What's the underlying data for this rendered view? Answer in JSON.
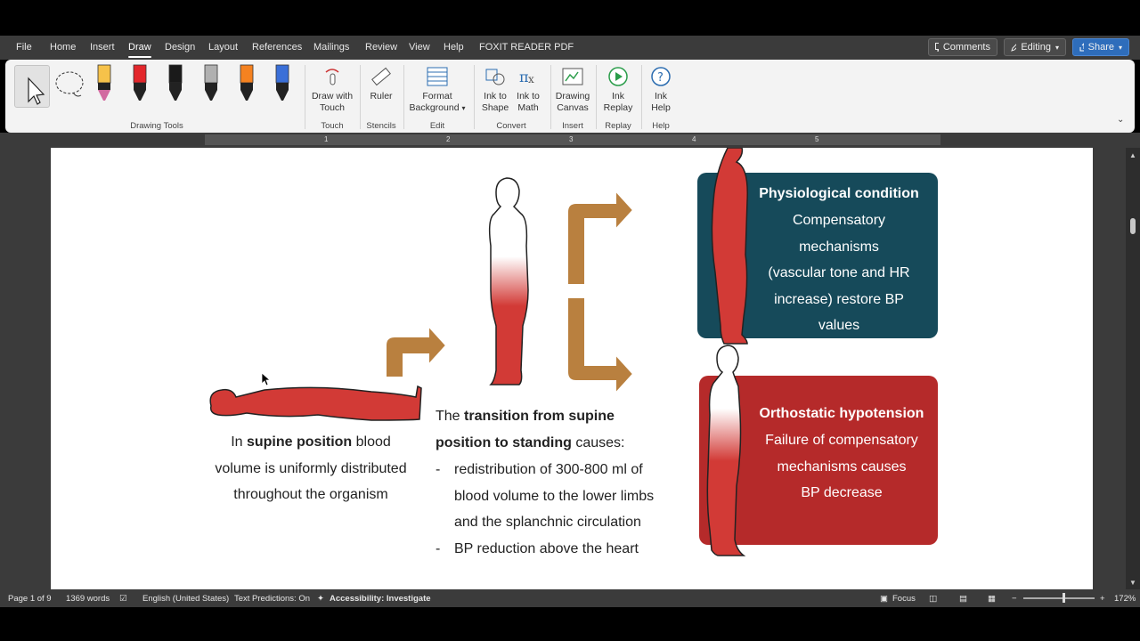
{
  "tabs": [
    "File",
    "Home",
    "Insert",
    "Draw",
    "Design",
    "Layout",
    "References",
    "Mailings",
    "Review",
    "View",
    "Help",
    "FOXIT READER PDF"
  ],
  "top_buttons": {
    "comments": "Comments",
    "editing": "Editing",
    "share": "Share"
  },
  "ribbon": {
    "groups": {
      "drawing_tools": "Drawing Tools",
      "touch": "Touch",
      "stencils": "Stencils",
      "edit": "Edit",
      "convert": "Convert",
      "insert": "Insert",
      "replay": "Replay",
      "help": "Help"
    },
    "buttons": {
      "draw_with_touch": [
        "Draw with",
        "Touch"
      ],
      "ruler": "Ruler",
      "format_background": [
        "Format",
        "Background"
      ],
      "ink_to_shape": [
        "Ink to",
        "Shape"
      ],
      "ink_to_math": [
        "Ink to",
        "Math"
      ],
      "drawing_canvas": [
        "Drawing",
        "Canvas"
      ],
      "ink_replay": [
        "Ink",
        "Replay"
      ],
      "ink_help": [
        "Ink",
        "Help"
      ]
    },
    "pen_colors": [
      "#f6c24a",
      "#e3262b",
      "#1a1a1a",
      "#b0b0b0",
      "#f58220",
      "#3a6fd8"
    ]
  },
  "ruler_numbers": [
    "1",
    "2",
    "3",
    "4",
    "5"
  ],
  "document": {
    "supine": {
      "line1_a": "In ",
      "line1_b": "supine position",
      "line1_c": " blood",
      "line2": "volume is uniformly distributed",
      "line3": "throughout the organism"
    },
    "transition": {
      "line1_a": "The ",
      "line1_b": "transition from supine",
      "line2_b": "position to standing",
      "line2_c": " causes:",
      "bullet_marker": "-",
      "bullet1_line1": "redistribution of 300-800 ml of",
      "bullet1_line2": "blood volume to the lower limbs",
      "bullet1_line3": "and the splanchnic circulation",
      "bullet2": "BP reduction above the heart"
    },
    "card_physio": {
      "title": "Physiological condition",
      "lines": [
        "Compensatory",
        "mechanisms",
        "(vascular tone and HR",
        "increase) restore BP",
        "values"
      ],
      "color": "#164a5a"
    },
    "card_ortho": {
      "title": "Orthostatic hypotension",
      "lines": [
        "Failure of compensatory",
        "mechanisms causes",
        "BP decrease"
      ],
      "color": "#b52a2a"
    },
    "body_color": "#d23a36",
    "arrow_color": "#b9803f"
  },
  "status": {
    "page": "Page 1 of 9",
    "words": "1369 words",
    "language": "English (United States)",
    "predictions": "Text Predictions: On",
    "accessibility": "Accessibility: Investigate",
    "focus": "Focus",
    "zoom": "172%"
  }
}
